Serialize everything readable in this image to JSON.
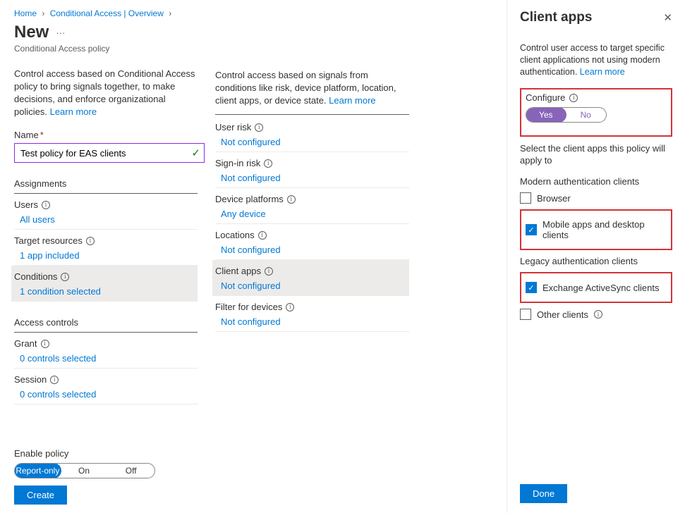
{
  "breadcrumb": {
    "home": "Home",
    "ca": "Conditional Access | Overview"
  },
  "title": "New",
  "subtitle": "Conditional Access policy",
  "left": {
    "desc": "Control access based on Conditional Access policy to bring signals together, to make decisions, and enforce organizational policies.",
    "learn_more": "Learn more",
    "name_label": "Name",
    "name_value": "Test policy for EAS clients",
    "assignments_header": "Assignments",
    "users": {
      "label": "Users",
      "value": "All users"
    },
    "targets": {
      "label": "Target resources",
      "value": "1 app included"
    },
    "conditions": {
      "label": "Conditions",
      "value": "1 condition selected"
    },
    "access_header": "Access controls",
    "grant": {
      "label": "Grant",
      "value": "0 controls selected"
    },
    "session": {
      "label": "Session",
      "value": "0 controls selected"
    },
    "enable_label": "Enable policy",
    "toggle": {
      "report": "Report-only",
      "on": "On",
      "off": "Off"
    },
    "create": "Create"
  },
  "mid": {
    "desc": "Control access based on signals from conditions like risk, device platform, location, client apps, or device state.",
    "learn_more": "Learn more",
    "user_risk": {
      "label": "User risk",
      "value": "Not configured"
    },
    "signin_risk": {
      "label": "Sign-in risk",
      "value": "Not configured"
    },
    "device_platforms": {
      "label": "Device platforms",
      "value": "Any device"
    },
    "locations": {
      "label": "Locations",
      "value": "Not configured"
    },
    "client_apps": {
      "label": "Client apps",
      "value": "Not configured"
    },
    "filter_devices": {
      "label": "Filter for devices",
      "value": "Not configured"
    }
  },
  "panel": {
    "title": "Client apps",
    "desc": "Control user access to target specific client applications not using modern authentication.",
    "learn_more": "Learn more",
    "configure_label": "Configure",
    "yes": "Yes",
    "no": "No",
    "select_text": "Select the client apps this policy will apply to",
    "group_modern": "Modern authentication clients",
    "cb_browser": "Browser",
    "cb_mobile": "Mobile apps and desktop clients",
    "group_legacy": "Legacy authentication clients",
    "cb_eas": "Exchange ActiveSync clients",
    "cb_other": "Other clients",
    "done": "Done"
  }
}
